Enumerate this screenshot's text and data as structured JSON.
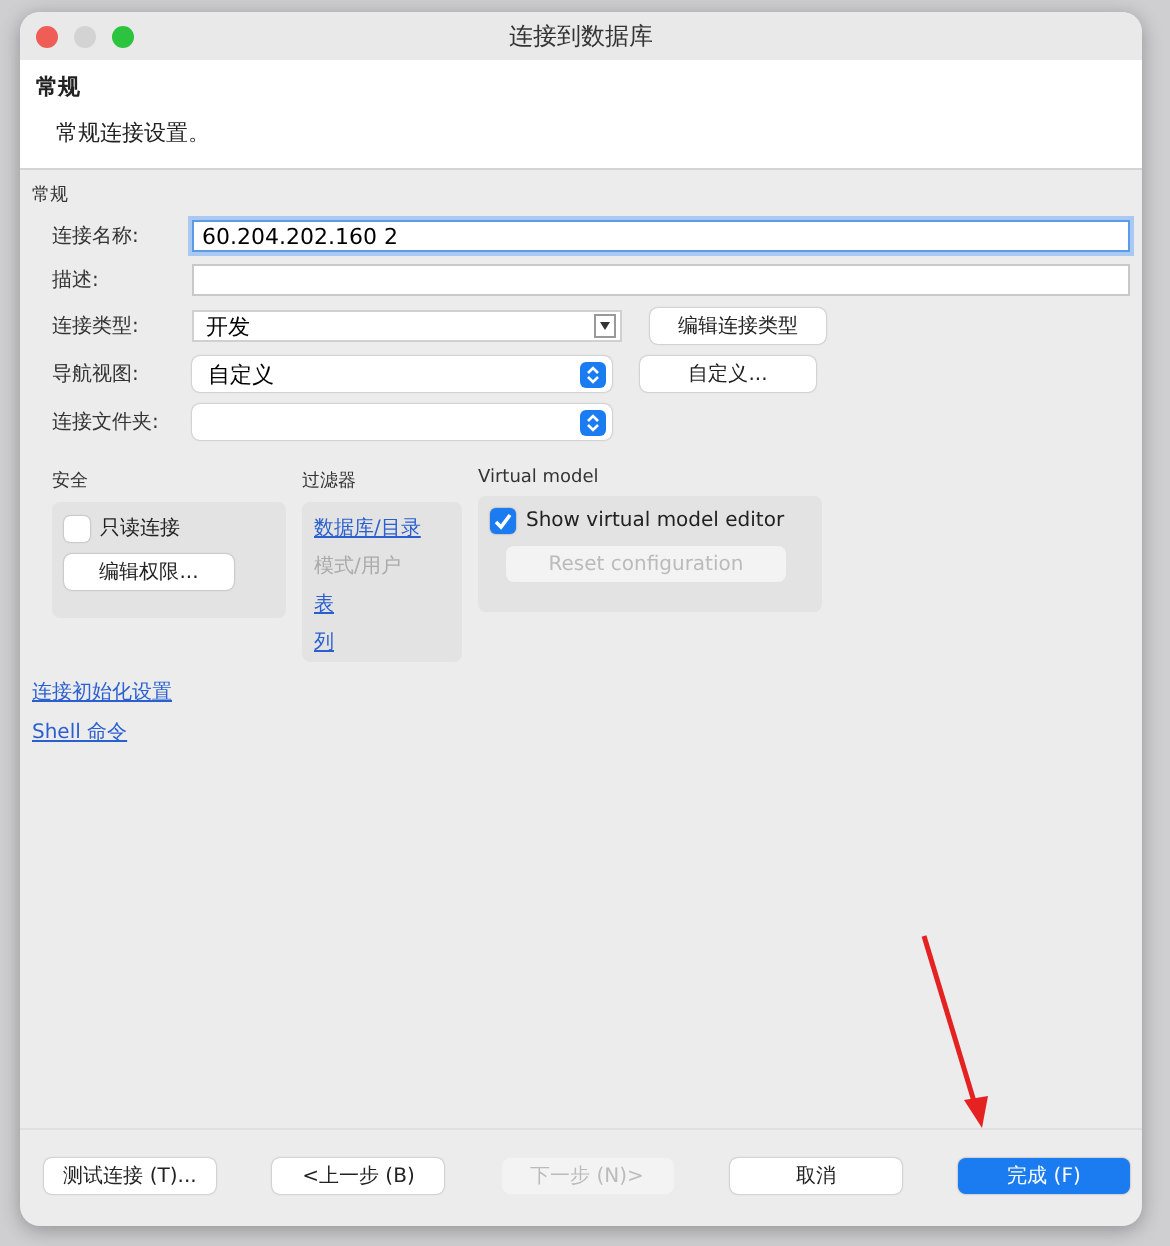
{
  "window": {
    "title": "连接到数据库"
  },
  "header": {
    "title": "常规",
    "description": "常规连接设置。"
  },
  "general": {
    "group_label": "常规",
    "fields": [
      {
        "kind": "text",
        "label": "连接名称:",
        "value": "60.204.202.160 2",
        "focused": true
      },
      {
        "kind": "text",
        "label": "描述:",
        "focused": false
      },
      {
        "kind": "combo",
        "label": "连接类型:",
        "value": "开发",
        "button": "编辑连接类型"
      },
      {
        "kind": "select",
        "label": "导航视图:",
        "value": "自定义",
        "button": "自定义..."
      },
      {
        "kind": "select",
        "label": "连接文件夹:"
      }
    ]
  },
  "security": {
    "label": "安全",
    "readonly": {
      "label": "只读连接",
      "checked": false
    },
    "button": "编辑权限..."
  },
  "filters": {
    "label": "过滤器",
    "items": [
      {
        "label": "数据库/目录",
        "disabled": false
      },
      {
        "label": "模式/用户",
        "disabled": true
      },
      {
        "label": "表",
        "disabled": false
      },
      {
        "label": "列",
        "disabled": false
      }
    ]
  },
  "virtual_model": {
    "label": "Virtual model",
    "show_editor": {
      "label": "Show virtual model editor",
      "checked": true
    },
    "button": {
      "label": "Reset configuration",
      "disabled": true
    }
  },
  "links": [
    "连接初始化设置",
    "Shell 命令"
  ],
  "buttons": [
    {
      "label": "测试连接 (T)...",
      "kind": "normal",
      "disabled": false
    },
    {
      "label": "<上一步 (B)",
      "kind": "normal",
      "disabled": false
    },
    {
      "label": "下一步 (N)>",
      "kind": "normal",
      "disabled": true
    },
    {
      "label": "取消",
      "kind": "normal",
      "disabled": false
    },
    {
      "label": "完成 (F)",
      "kind": "primary",
      "disabled": false
    }
  ]
}
